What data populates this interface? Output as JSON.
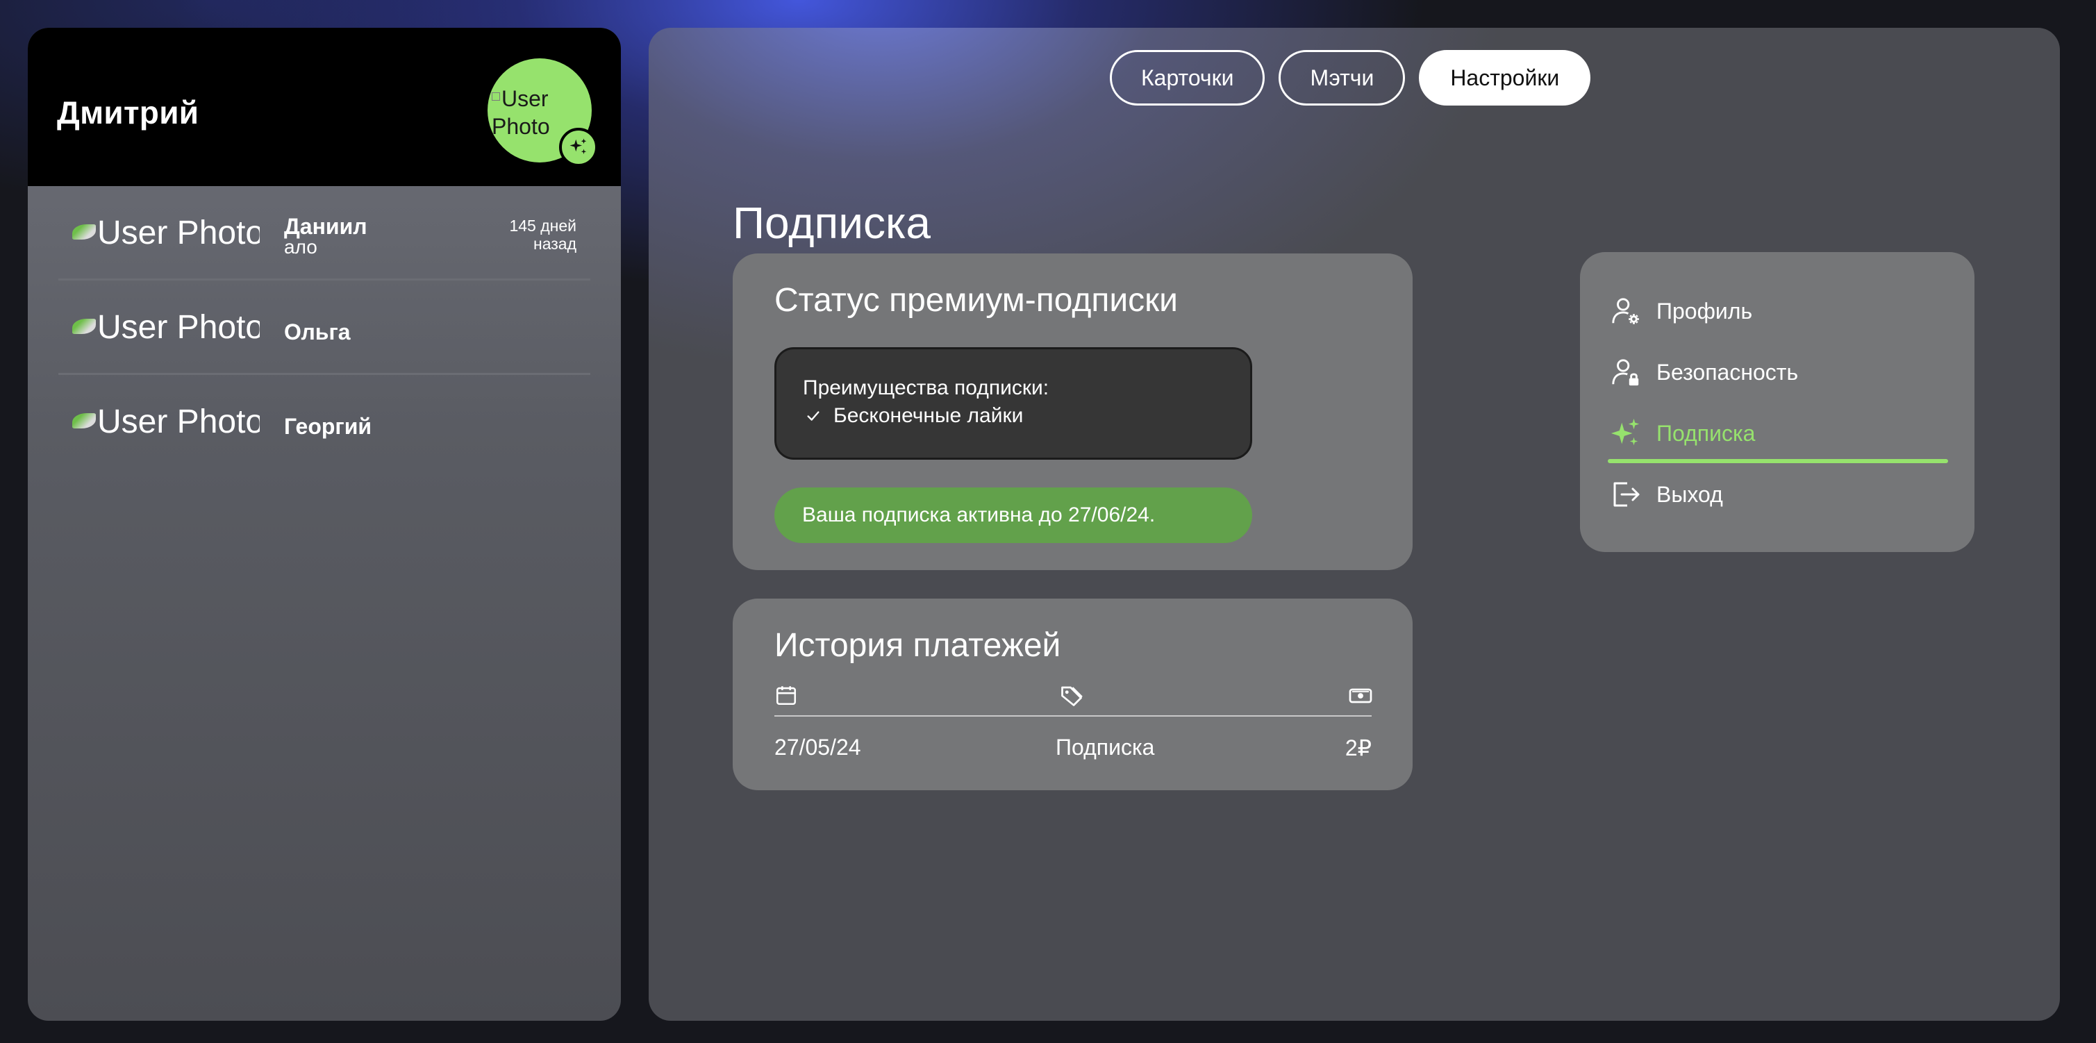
{
  "left_panel": {
    "user_name": "Дмитрий",
    "avatar_alt": "User Photo",
    "chats": [
      {
        "photo_alt": "User Photo",
        "name": "Даниил",
        "message": "ало",
        "time": "145 дней назад"
      },
      {
        "photo_alt": "User Photo",
        "name": "Ольга",
        "message": "",
        "time": ""
      },
      {
        "photo_alt": "User Photo",
        "name": "Георгий",
        "message": "",
        "time": ""
      }
    ]
  },
  "nav": {
    "tabs": [
      {
        "label": "Карточки",
        "active": false
      },
      {
        "label": "Мэтчи",
        "active": false
      },
      {
        "label": "Настройки",
        "active": true
      }
    ]
  },
  "page": {
    "title": "Подписка"
  },
  "status_card": {
    "title": "Статус премиум-подписки",
    "benefits_title": "Преимущества подписки:",
    "benefits": [
      "Бесконечные лайки"
    ],
    "active_text": "Ваша подписка активна до 27/06/24."
  },
  "history_card": {
    "title": "История платежей",
    "columns": [
      "calendar-icon",
      "tag-icon",
      "money-icon"
    ],
    "rows": [
      {
        "date": "27/05/24",
        "item": "Подписка",
        "amount": "2₽"
      }
    ]
  },
  "settings_menu": {
    "items": [
      {
        "label": "Профиль",
        "icon": "user-gear-icon",
        "active": false
      },
      {
        "label": "Безопасность",
        "icon": "user-lock-icon",
        "active": false
      },
      {
        "label": "Подписка",
        "icon": "sparkles-icon",
        "active": true
      },
      {
        "label": "Выход",
        "icon": "logout-icon",
        "active": false
      }
    ]
  },
  "colors": {
    "accent": "#96e26d",
    "active_banner": "#62a14b",
    "card": "#757678",
    "benefits_box": "#363636"
  }
}
